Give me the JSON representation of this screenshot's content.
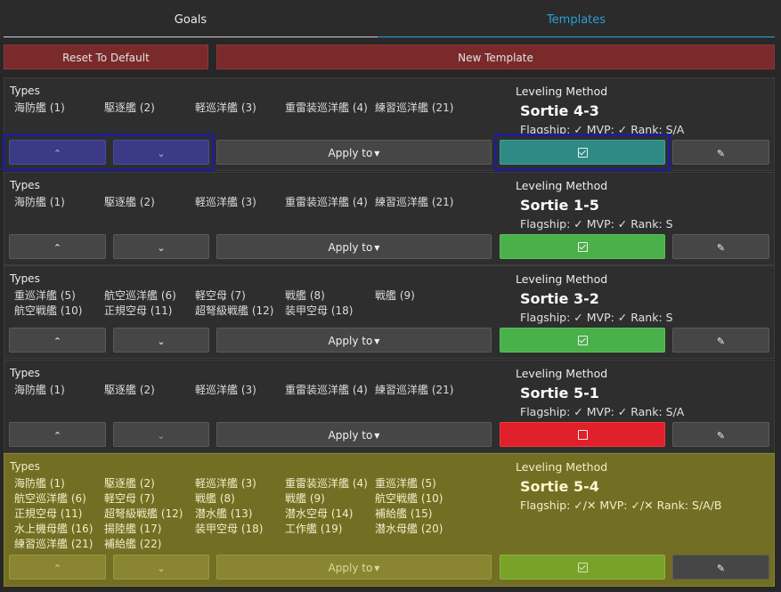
{
  "tabs": {
    "goals": "Goals",
    "templates": "Templates"
  },
  "toolbar": {
    "reset": "Reset To Default",
    "new": "New Template"
  },
  "labels": {
    "types": "Types",
    "leveling": "Leveling Method",
    "apply": "Apply to",
    "up": "⌃",
    "down": "⌄",
    "edit": "✎"
  },
  "rows": [
    {
      "types": [
        "海防艦 (1)",
        "駆逐艦 (2)",
        "軽巡洋艦 (3)",
        "重雷装巡洋艦 (4)",
        "練習巡洋艦 (21)"
      ],
      "sortie": "Sortie 4-3",
      "flags": "Flagship: ✓ MVP: ✓ Rank: S/A",
      "state": "checked",
      "state_color": "teal"
    },
    {
      "types": [
        "海防艦 (1)",
        "駆逐艦 (2)",
        "軽巡洋艦 (3)",
        "重雷装巡洋艦 (4)",
        "練習巡洋艦 (21)"
      ],
      "sortie": "Sortie 1-5",
      "flags": "Flagship: ✓ MVP: ✓ Rank: S",
      "state": "checked",
      "state_color": "green"
    },
    {
      "types": [
        "重巡洋艦 (5)",
        "航空巡洋艦 (6)",
        "軽空母 (7)",
        "戦艦 (8)",
        "戦艦 (9)",
        "航空戦艦 (10)",
        "正規空母 (11)",
        "超弩級戦艦 (12)",
        "装甲空母 (18)"
      ],
      "sortie": "Sortie 3-2",
      "flags": "Flagship: ✓ MVP: ✓ Rank: S",
      "state": "checked",
      "state_color": "green"
    },
    {
      "types": [
        "海防艦 (1)",
        "駆逐艦 (2)",
        "軽巡洋艦 (3)",
        "重雷装巡洋艦 (4)",
        "練習巡洋艦 (21)"
      ],
      "sortie": "Sortie 5-1",
      "flags": "Flagship: ✓ MVP: ✓ Rank: S/A",
      "state": "unchecked",
      "state_color": "red"
    },
    {
      "types": [
        "海防艦 (1)",
        "駆逐艦 (2)",
        "軽巡洋艦 (3)",
        "重雷装巡洋艦 (4)",
        "重巡洋艦 (5)",
        "航空巡洋艦 (6)",
        "軽空母 (7)",
        "戦艦 (8)",
        "戦艦 (9)",
        "航空戦艦 (10)",
        "正規空母 (11)",
        "超弩級戦艦 (12)",
        "潜水艦 (13)",
        "潜水空母 (14)",
        "補給艦 (15)",
        "水上機母艦 (16)",
        "揚陸艦 (17)",
        "装甲空母 (18)",
        "工作艦 (19)",
        "潜水母艦 (20)",
        "練習巡洋艦 (21)",
        "補給艦 (22)"
      ],
      "sortie": "Sortie 5-4",
      "flags": "Flagship: ✓/✕ MVP: ✓/✕ Rank: S/A/B",
      "state": "checked",
      "state_color": "lime"
    }
  ]
}
